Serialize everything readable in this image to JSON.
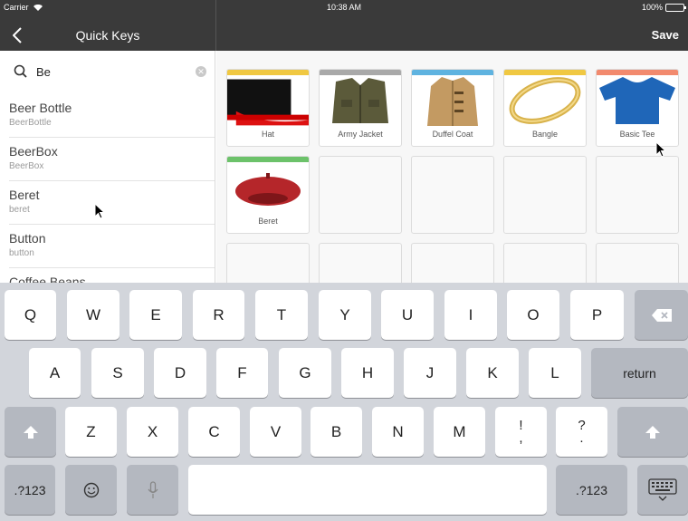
{
  "status": {
    "carrier": "Carrier",
    "time": "10:38 AM",
    "battery": "100%"
  },
  "nav": {
    "title": "Quick Keys",
    "save": "Save"
  },
  "search": {
    "value": "Be"
  },
  "list": [
    {
      "title": "Beer Bottle",
      "sub": "BeerBottle"
    },
    {
      "title": "BeerBox",
      "sub": "BeerBox"
    },
    {
      "title": "Beret",
      "sub": "beret"
    },
    {
      "title": "Button",
      "sub": "button"
    },
    {
      "title": "Coffee Beans",
      "sub": ""
    }
  ],
  "tiles": [
    {
      "label": "Hat",
      "color": "#f0c842",
      "icon": "top-hat-icon"
    },
    {
      "label": "Army Jacket",
      "color": "#a9a9a9",
      "icon": "army-jacket-icon"
    },
    {
      "label": "Duffel Coat",
      "color": "#5fb3e0",
      "icon": "duffel-coat-icon"
    },
    {
      "label": "Bangle",
      "color": "#f0c842",
      "icon": "bangle-icon"
    },
    {
      "label": "Basic Tee",
      "color": "#f28a6e",
      "icon": "tee-icon"
    },
    {
      "label": "Beret",
      "color": "#6cc26a",
      "icon": "beret-icon"
    }
  ],
  "keyboard": {
    "row1": [
      "Q",
      "W",
      "E",
      "R",
      "T",
      "Y",
      "U",
      "I",
      "O",
      "P"
    ],
    "row2": [
      "A",
      "S",
      "D",
      "F",
      "G",
      "H",
      "J",
      "K",
      "L"
    ],
    "row3": [
      "Z",
      "X",
      "C",
      "V",
      "B",
      "N",
      "M"
    ],
    "row3_punct": [
      {
        "top": "!",
        "bottom": ","
      },
      {
        "top": "?",
        "bottom": "."
      }
    ],
    "return": "return",
    "numbers": ".?123"
  }
}
